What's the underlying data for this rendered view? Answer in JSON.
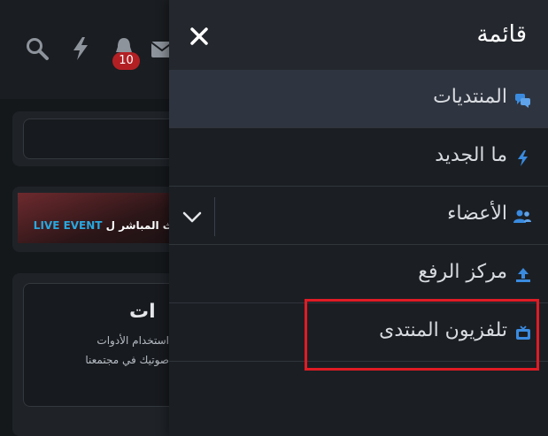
{
  "topbar": {
    "notification_count": "10",
    "icons": [
      "search-icon",
      "bolt-icon",
      "bell-icon",
      "mail-icon"
    ]
  },
  "background": {
    "banner_live": "LIVE EVENT",
    "banner_text": "البث المباشر ل",
    "card_title": "ات",
    "card_line1": "استخدام الأدوات",
    "card_line2": "صوتيك في مجتمعنا"
  },
  "menu": {
    "title": "قائمة",
    "close_icon": "close-icon",
    "items": [
      {
        "label": "المنتديات",
        "icon": "comments-icon",
        "active": true
      },
      {
        "label": "ما الجديد",
        "icon": "bolt-icon",
        "active": false
      },
      {
        "label": "الأعضاء",
        "icon": "users-icon",
        "active": false,
        "expandable": true
      },
      {
        "label": "مركز الرفع",
        "icon": "upload-icon",
        "active": false
      },
      {
        "label": "تلفزيون المنتدى",
        "icon": "tv-icon",
        "active": false
      }
    ]
  },
  "colors": {
    "accent": "#3a8be0",
    "highlight": "#e01b24",
    "badge": "#b22024"
  }
}
